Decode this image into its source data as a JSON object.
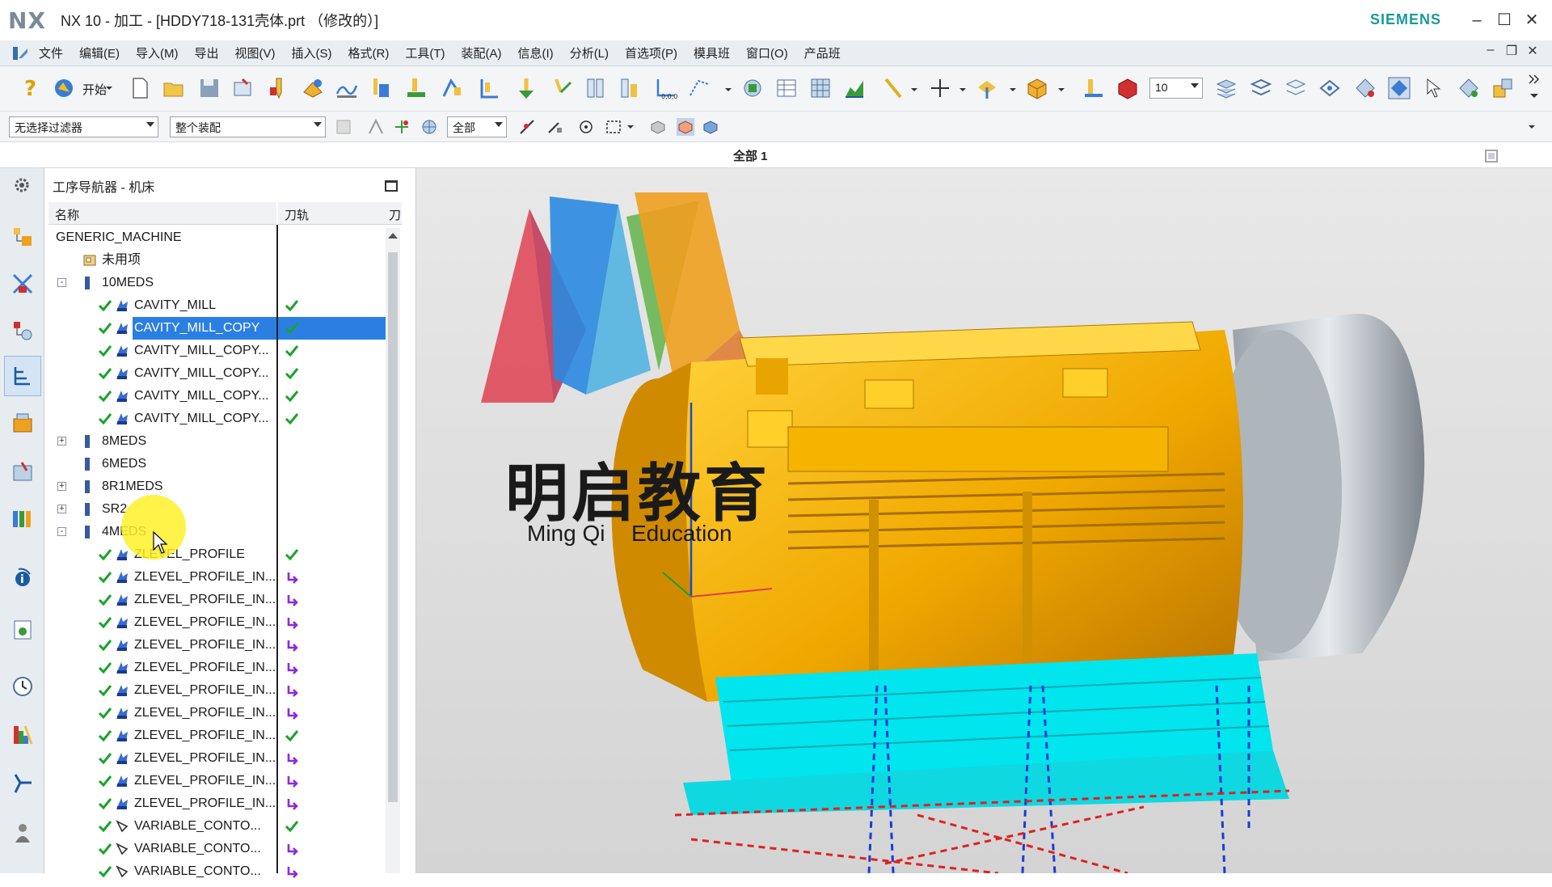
{
  "app": {
    "logo": "NX",
    "title": "NX 10 - 加工 - [HDDY718-131壳体.prt （修改的）]",
    "brand": "SIEMENS"
  },
  "menu": [
    "文件",
    "编辑(E)",
    "导入(M)",
    "导出",
    "视图(V)",
    "插入(S)",
    "格式(R)",
    "工具(T)",
    "装配(A)",
    "信息(I)",
    "分析(L)",
    "首选项(P)",
    "模具班",
    "窗口(O)",
    "产品班"
  ],
  "toolbar": {
    "start_label": "开始",
    "layer_value": "10"
  },
  "selection_bar": {
    "filter_value": "无选择过滤器",
    "scope_value": "整个装配",
    "type_value": "全部"
  },
  "viewport": {
    "title": "全部 1",
    "watermark_cn": "明启教育",
    "watermark_en1": "Ming Qi",
    "watermark_en2": "Education"
  },
  "navigator": {
    "title": "工序导航器 - 机床",
    "col_name": "名称",
    "col_path": "刀轨",
    "col_extra": "刀",
    "rows": [
      {
        "name": "GENERIC_MACHINE",
        "level": 0,
        "type": "machine",
        "status": ""
      },
      {
        "name": "未用项",
        "level": 1,
        "type": "unused",
        "status": ""
      },
      {
        "name": "10MEDS",
        "level": 1,
        "type": "tool",
        "status": "",
        "expander": "-"
      },
      {
        "name": "CAVITY_MILL",
        "level": 2,
        "type": "op",
        "status": "ok"
      },
      {
        "name": "CAVITY_MILL_COPY",
        "level": 2,
        "type": "op",
        "status": "ok",
        "selected": true
      },
      {
        "name": "CAVITY_MILL_COPY...",
        "level": 2,
        "type": "op",
        "status": "ok"
      },
      {
        "name": "CAVITY_MILL_COPY...",
        "level": 2,
        "type": "op",
        "status": "ok"
      },
      {
        "name": "CAVITY_MILL_COPY...",
        "level": 2,
        "type": "op",
        "status": "ok"
      },
      {
        "name": "CAVITY_MILL_COPY...",
        "level": 2,
        "type": "op",
        "status": "ok"
      },
      {
        "name": "8MEDS",
        "level": 1,
        "type": "tool",
        "status": "",
        "expander": "+"
      },
      {
        "name": "6MEDS",
        "level": 1,
        "type": "tool",
        "status": ""
      },
      {
        "name": "8R1MEDS",
        "level": 1,
        "type": "tool",
        "status": "",
        "expander": "+"
      },
      {
        "name": "SR2",
        "level": 1,
        "type": "tool",
        "status": "",
        "expander": "+"
      },
      {
        "name": "4MEDS",
        "level": 1,
        "type": "tool",
        "status": "",
        "expander": "-"
      },
      {
        "name": "ZLEVEL_PROFILE",
        "level": 2,
        "type": "op",
        "status": "ok"
      },
      {
        "name": "ZLEVEL_PROFILE_IN...",
        "level": 2,
        "type": "op",
        "status": "regen"
      },
      {
        "name": "ZLEVEL_PROFILE_IN...",
        "level": 2,
        "type": "op",
        "status": "regen"
      },
      {
        "name": "ZLEVEL_PROFILE_IN...",
        "level": 2,
        "type": "op",
        "status": "regen"
      },
      {
        "name": "ZLEVEL_PROFILE_IN...",
        "level": 2,
        "type": "op",
        "status": "regen"
      },
      {
        "name": "ZLEVEL_PROFILE_IN...",
        "level": 2,
        "type": "op",
        "status": "regen"
      },
      {
        "name": "ZLEVEL_PROFILE_IN...",
        "level": 2,
        "type": "op",
        "status": "regen"
      },
      {
        "name": "ZLEVEL_PROFILE_IN...",
        "level": 2,
        "type": "op",
        "status": "regen"
      },
      {
        "name": "ZLEVEL_PROFILE_IN...",
        "level": 2,
        "type": "op",
        "status": "ok"
      },
      {
        "name": "ZLEVEL_PROFILE_IN...",
        "level": 2,
        "type": "op",
        "status": "regen"
      },
      {
        "name": "ZLEVEL_PROFILE_IN...",
        "level": 2,
        "type": "op",
        "status": "regen"
      },
      {
        "name": "ZLEVEL_PROFILE_IN...",
        "level": 2,
        "type": "op",
        "status": "regen"
      },
      {
        "name": "VARIABLE_CONTO...",
        "level": 2,
        "type": "op2",
        "status": "ok"
      },
      {
        "name": "VARIABLE_CONTO...",
        "level": 2,
        "type": "op2",
        "status": "regen"
      },
      {
        "name": "VARIABLE_CONTO...",
        "level": 2,
        "type": "op2",
        "status": "regen"
      }
    ]
  },
  "colors": {
    "accent": "#2b7fe3",
    "ok": "#1aa32a",
    "regen": "#8a2bd8",
    "part": "#f2b200",
    "toolpath": "#00e5ee"
  }
}
